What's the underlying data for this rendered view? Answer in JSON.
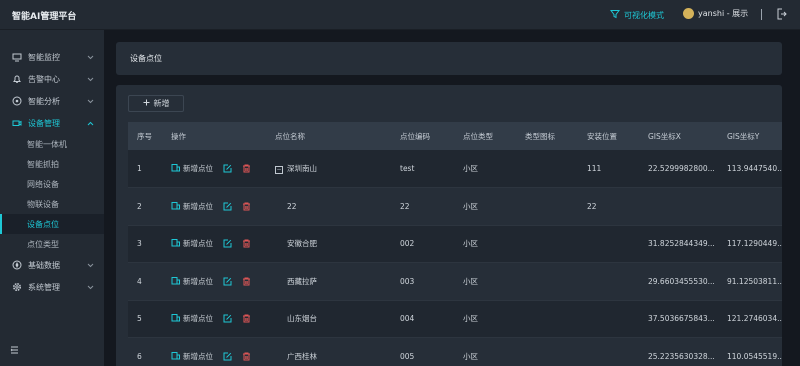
{
  "app": {
    "title": "智能AI管理平台"
  },
  "topbar": {
    "viz_mode": "可视化模式",
    "user": "yanshi - 展示"
  },
  "sidebar": {
    "items": [
      {
        "label": "智能监控",
        "icon": "monitor-icon"
      },
      {
        "label": "告警中心",
        "icon": "bell-icon"
      },
      {
        "label": "智能分析",
        "icon": "compass-icon"
      },
      {
        "label": "设备管理",
        "icon": "camera-icon",
        "open": true,
        "children": [
          "智能一体机",
          "智能抓拍",
          "网络设备",
          "物联设备",
          "设备点位",
          "点位类型"
        ],
        "active_child": "设备点位"
      },
      {
        "label": "基础数据",
        "icon": "target-icon"
      },
      {
        "label": "系统管理",
        "icon": "gear-icon"
      }
    ]
  },
  "page": {
    "title": "设备点位",
    "add_label": "新增"
  },
  "table": {
    "columns": [
      "序号",
      "操作",
      "点位名称",
      "点位编码",
      "点位类型",
      "类型图标",
      "安装位置",
      "GIS坐标X",
      "GIS坐标Y"
    ],
    "op_add_label": "新增点位",
    "rows": [
      {
        "idx": "1",
        "name": "深圳南山",
        "code": "test",
        "type": "小区",
        "icon": "",
        "location": "111",
        "x": "22.5299982800...",
        "y": "113.9447540...",
        "tree": true
      },
      {
        "idx": "2",
        "name": "22",
        "code": "22",
        "type": "小区",
        "icon": "",
        "location": "22",
        "x": "",
        "y": ""
      },
      {
        "idx": "3",
        "name": "安徽合肥",
        "code": "002",
        "type": "小区",
        "icon": "",
        "location": "",
        "x": "31.8252844349...",
        "y": "117.1290449..."
      },
      {
        "idx": "4",
        "name": "西藏拉萨",
        "code": "003",
        "type": "小区",
        "icon": "",
        "location": "",
        "x": "29.6603455530...",
        "y": "91.12503811..."
      },
      {
        "idx": "5",
        "name": "山东烟台",
        "code": "004",
        "type": "小区",
        "icon": "",
        "location": "",
        "x": "37.5036675843...",
        "y": "121.2746034..."
      },
      {
        "idx": "6",
        "name": "广西桂林",
        "code": "005",
        "type": "小区",
        "icon": "",
        "location": "",
        "x": "25.2235630328...",
        "y": "110.0545519..."
      }
    ]
  },
  "colors": {
    "accent": "#1ec8d6",
    "delete": "#e05656",
    "bg": "#14181f",
    "panel": "#262e38"
  }
}
